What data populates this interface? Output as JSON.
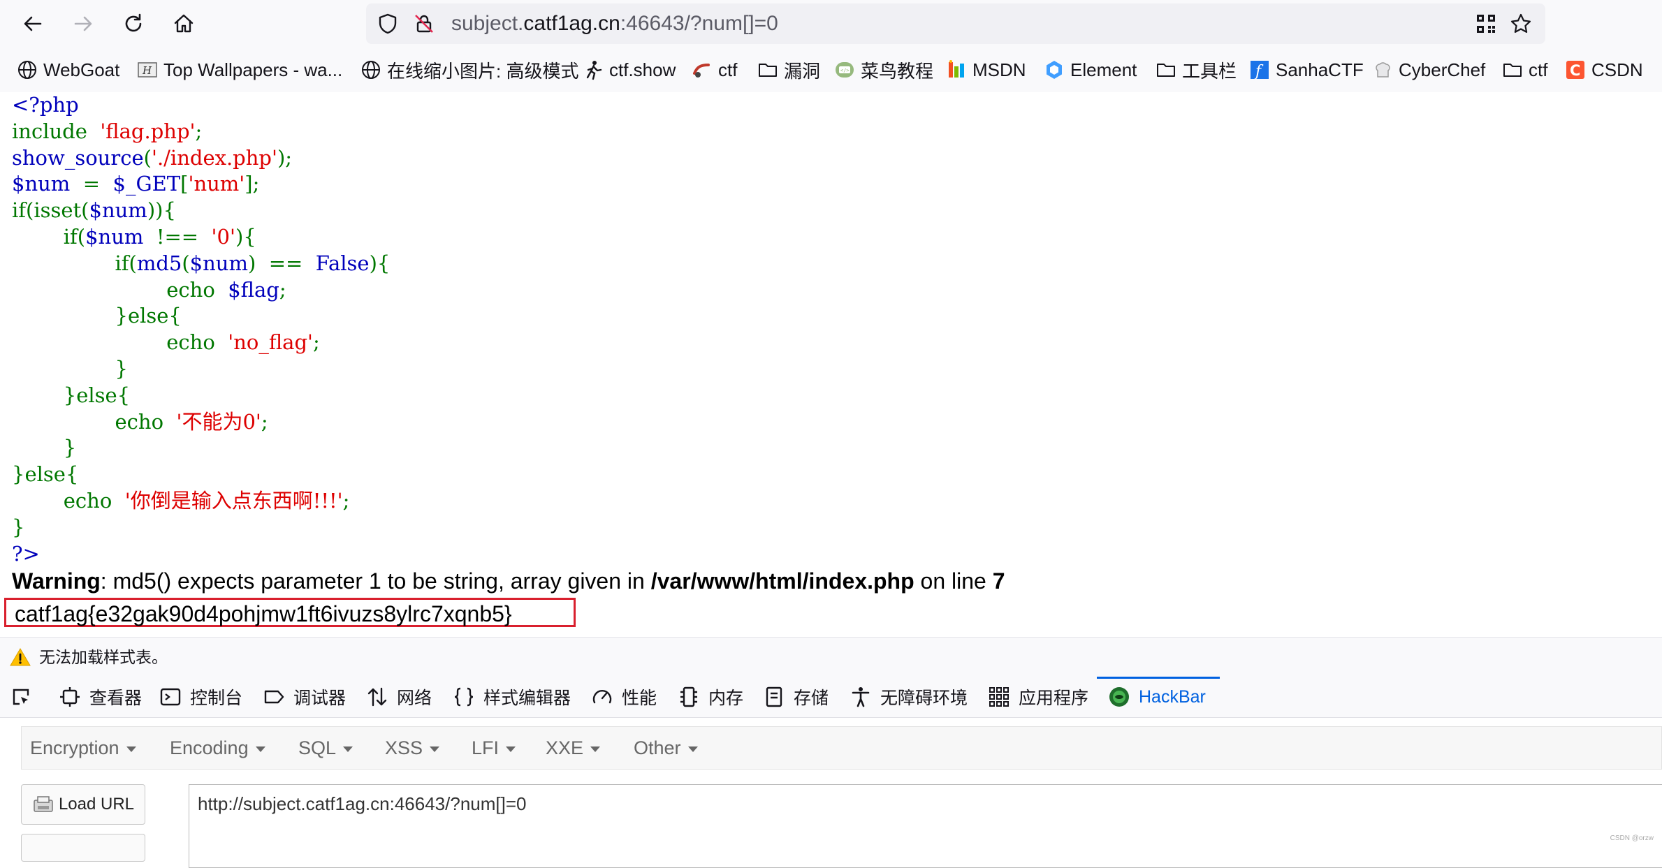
{
  "browser": {
    "url_prefix": "subject.",
    "url_host": "catf1ag.cn",
    "url_suffix": ":46643/?num[]=0"
  },
  "bookmarks": [
    {
      "label": "WebGoat",
      "icon": "globe-icon"
    },
    {
      "label": "Top Wallpapers - wa...",
      "icon": "wallpaper-icon"
    },
    {
      "label": "在线缩小图片: 高级模式",
      "icon": "globe-icon"
    },
    {
      "label": "ctf.show",
      "icon": "runner-icon"
    },
    {
      "label": "ctf",
      "icon": "ctf-icon"
    },
    {
      "label": "漏洞",
      "icon": "folder-icon"
    },
    {
      "label": "菜鸟教程",
      "icon": "runoob-icon"
    },
    {
      "label": "MSDN",
      "icon": "msdn-icon"
    },
    {
      "label": "Element",
      "icon": "element-icon"
    },
    {
      "label": "工具栏",
      "icon": "folder-icon"
    },
    {
      "label": "SanhaCTF",
      "icon": "sanha-icon"
    },
    {
      "label": "CyberChef",
      "icon": "chef-icon"
    },
    {
      "label": "ctf",
      "icon": "folder-icon"
    },
    {
      "label": "CSDN",
      "icon": "csdn-icon"
    }
  ],
  "code_lines": [
    [
      {
        "t": "<?php",
        "c": "blue"
      }
    ],
    [
      {
        "t": "include  ",
        "c": "green"
      },
      {
        "t": "'flag.php'",
        "c": "red"
      },
      {
        "t": ";",
        "c": "green"
      }
    ],
    [
      {
        "t": "show_source",
        "c": "blue"
      },
      {
        "t": "(",
        "c": "green"
      },
      {
        "t": "'./index.php'",
        "c": "red"
      },
      {
        "t": ");",
        "c": "green"
      }
    ],
    [
      {
        "t": "$num  ",
        "c": "blue"
      },
      {
        "t": "=  ",
        "c": "green"
      },
      {
        "t": "$_GET",
        "c": "blue"
      },
      {
        "t": "[",
        "c": "green"
      },
      {
        "t": "'num'",
        "c": "red"
      },
      {
        "t": "];",
        "c": "green"
      }
    ],
    [
      {
        "t": "if(isset(",
        "c": "green"
      },
      {
        "t": "$num",
        "c": "blue"
      },
      {
        "t": ")){",
        "c": "green"
      }
    ],
    [
      {
        "t": "        if(",
        "c": "green"
      },
      {
        "t": "$num  ",
        "c": "blue"
      },
      {
        "t": "!==  ",
        "c": "green"
      },
      {
        "t": "'0'",
        "c": "red"
      },
      {
        "t": "){",
        "c": "green"
      }
    ],
    [
      {
        "t": "                if(",
        "c": "green"
      },
      {
        "t": "md5",
        "c": "blue"
      },
      {
        "t": "(",
        "c": "green"
      },
      {
        "t": "$num",
        "c": "blue"
      },
      {
        "t": ")  ",
        "c": "green"
      },
      {
        "t": "==  ",
        "c": "green"
      },
      {
        "t": "False",
        "c": "blue"
      },
      {
        "t": "){",
        "c": "green"
      }
    ],
    [
      {
        "t": "                        echo  ",
        "c": "green"
      },
      {
        "t": "$flag",
        "c": "blue"
      },
      {
        "t": ";",
        "c": "green"
      }
    ],
    [
      {
        "t": "                }else{",
        "c": "green"
      }
    ],
    [
      {
        "t": "                        echo  ",
        "c": "green"
      },
      {
        "t": "'no_flag'",
        "c": "red"
      },
      {
        "t": ";",
        "c": "green"
      }
    ],
    [
      {
        "t": "                }",
        "c": "green"
      }
    ],
    [
      {
        "t": "        }else{",
        "c": "green"
      }
    ],
    [
      {
        "t": "                echo  ",
        "c": "green"
      },
      {
        "t": "'不能为0'",
        "c": "red"
      },
      {
        "t": ";",
        "c": "green"
      }
    ],
    [
      {
        "t": "        }",
        "c": "green"
      }
    ],
    [
      {
        "t": "}else{",
        "c": "green"
      }
    ],
    [
      {
        "t": "        echo  ",
        "c": "green"
      },
      {
        "t": "'你倒是输入点东西啊!!!'",
        "c": "red"
      },
      {
        "t": ";",
        "c": "green"
      }
    ],
    [
      {
        "t": "}",
        "c": "green"
      }
    ],
    [
      {
        "t": "?>",
        "c": "blue"
      }
    ]
  ],
  "warning": {
    "label": "Warning",
    "message": ": md5() expects parameter 1 to be string, array given in ",
    "file": "/var/www/html/index.php",
    "on_line": " on line ",
    "line": "7"
  },
  "flag": "catf1ag{e32gak90d4pohjmw1ft6ivuzs8ylrc7xqnb5}",
  "notice": "无法加载样式表。",
  "devtools": {
    "tabs": [
      {
        "label": "查看器",
        "icon": "inspector-icon"
      },
      {
        "label": "控制台",
        "icon": "console-icon"
      },
      {
        "label": "调试器",
        "icon": "debugger-icon"
      },
      {
        "label": "网络",
        "icon": "network-icon"
      },
      {
        "label": "样式编辑器",
        "icon": "style-editor-icon"
      },
      {
        "label": "性能",
        "icon": "performance-icon"
      },
      {
        "label": "内存",
        "icon": "memory-icon"
      },
      {
        "label": "存储",
        "icon": "storage-icon"
      },
      {
        "label": "无障碍环境",
        "icon": "accessibility-icon"
      },
      {
        "label": "应用程序",
        "icon": "application-icon"
      },
      {
        "label": "HackBar",
        "icon": "hackbar-icon",
        "active": true
      }
    ]
  },
  "hackbar": {
    "menus": [
      "Encryption",
      "Encoding",
      "SQL",
      "XSS",
      "LFI",
      "XXE",
      "Other"
    ],
    "load_url": "Load URL",
    "url_value": "http://subject.catf1ag.cn:46643/?num[]=0"
  },
  "watermark": "CSDN @orzw",
  "colors": {
    "php_blue": "#0000bb",
    "php_green": "#007700",
    "php_red": "#dd0000",
    "accent": "#0061e0",
    "flag_border": "#d9202e"
  }
}
